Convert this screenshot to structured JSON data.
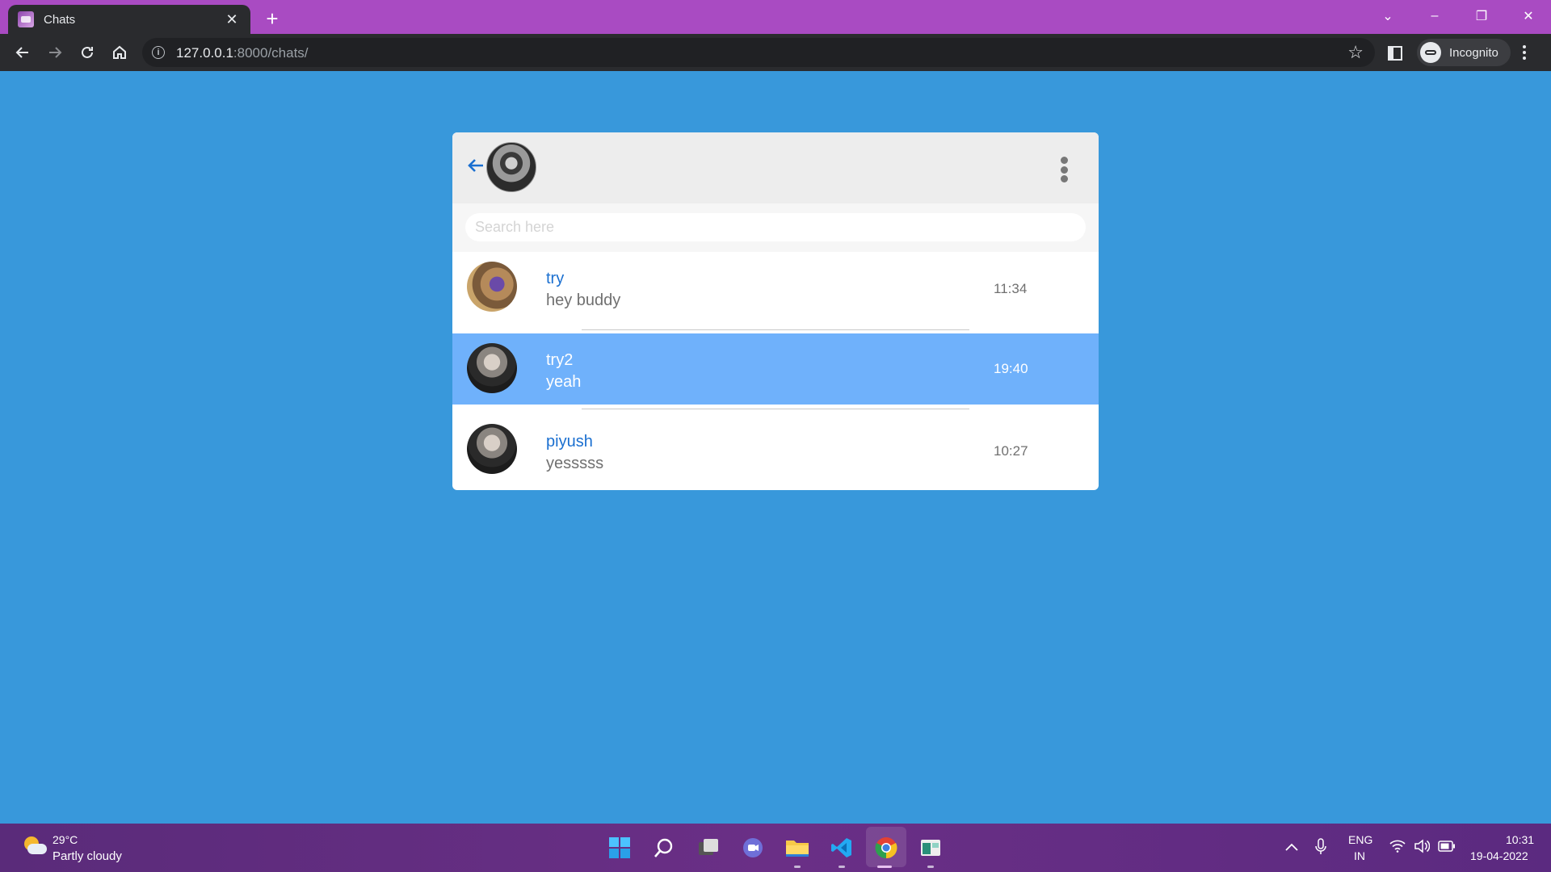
{
  "browser": {
    "tab_title": "Chats",
    "tab_close": "✕",
    "new_tab": "+",
    "url_host": "127.0.0.1",
    "url_rest": ":8000/chats/",
    "incognito_label": "Incognito",
    "window_controls": [
      "⌄",
      "–",
      "❐",
      "✕"
    ]
  },
  "chat_app": {
    "search_placeholder": "Search here",
    "accent_color": "#6fb1fb",
    "name_color": "#1a6fd0",
    "background_color": "#3898db",
    "chats": [
      {
        "name": "try",
        "message": "hey buddy",
        "time": "11:34",
        "active": false
      },
      {
        "name": "try2",
        "message": "yeah",
        "time": "19:40",
        "active": true
      },
      {
        "name": "piyush",
        "message": "yesssss",
        "time": "10:27",
        "active": false
      }
    ]
  },
  "taskbar": {
    "weather_temp": "29°C",
    "weather_desc": "Partly cloudy",
    "lang_line1": "ENG",
    "lang_line2": "IN",
    "clock_time": "10:31",
    "clock_date": "19-04-2022",
    "apps": [
      "start-icon",
      "search-icon",
      "task-view-icon",
      "teams-icon",
      "file-explorer-icon",
      "vscode-icon",
      "chrome-icon",
      "app-icon"
    ]
  }
}
